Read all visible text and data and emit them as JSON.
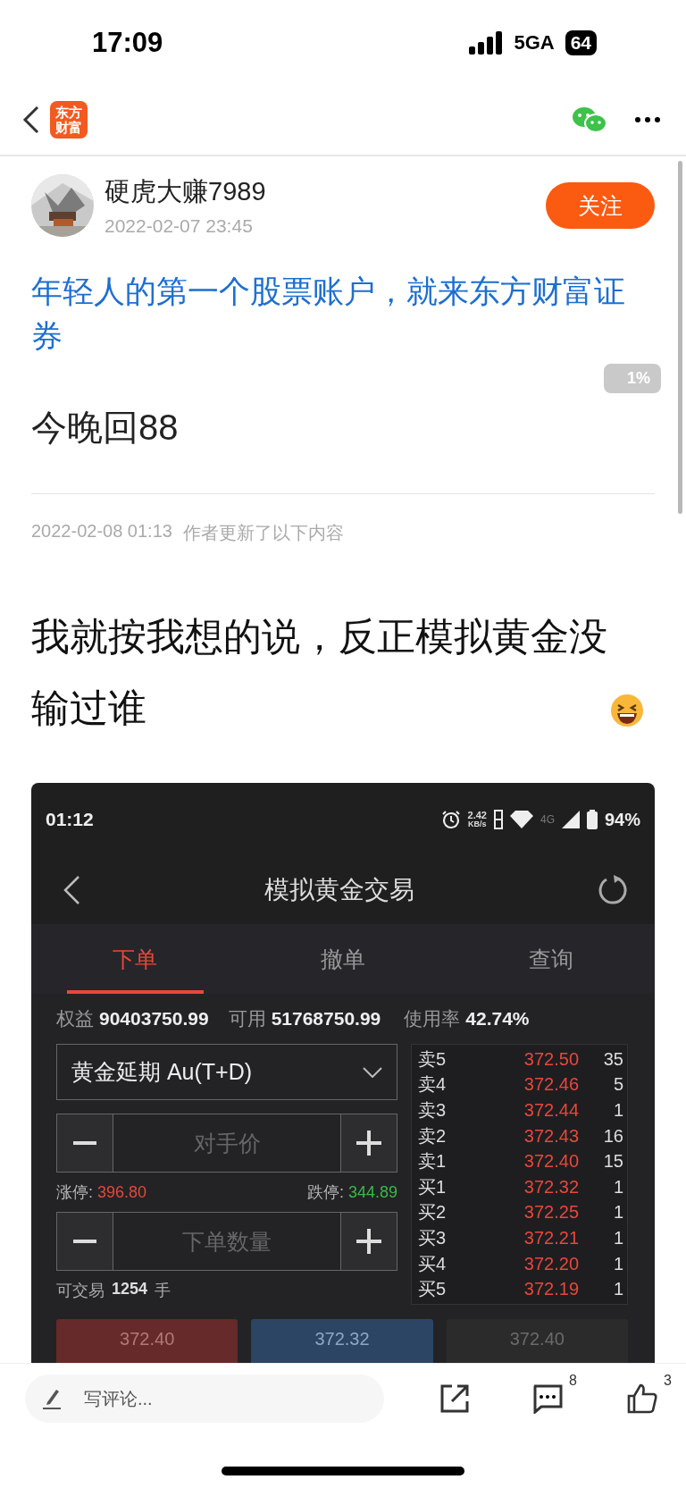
{
  "status_bar": {
    "time": "17:09",
    "network": "5GA",
    "battery": "64"
  },
  "app_bar": {
    "logo_lines": [
      "东方",
      "财富"
    ]
  },
  "post": {
    "author": "硬虎大赚7989",
    "date": "2022-02-07 23:45",
    "follow_button": "关注",
    "promo_link": "年轻人的第一个股票账户，就来东方财富证券",
    "title": "今晚回88",
    "update_time": "2022-02-08 01:13",
    "update_note": "作者更新了以下内容",
    "body": "我就按我想的说，反正模拟黄金没输过谁"
  },
  "scroll_indicator": {
    "label": "1%"
  },
  "screenshot": {
    "status_bar": {
      "time": "01:12",
      "speed": "2.42",
      "speed_unit": "KB/s",
      "network": "4G",
      "battery": "94%"
    },
    "title": "模拟黄金交易",
    "tabs": [
      {
        "label": "下单",
        "selected": true
      },
      {
        "label": "撤单",
        "selected": false
      },
      {
        "label": "查询",
        "selected": false
      }
    ],
    "summary": [
      {
        "label": "权益",
        "value": "90403750.99"
      },
      {
        "label": "可用",
        "value": "51768750.99"
      },
      {
        "label": "使用率",
        "value": "42.74%"
      }
    ],
    "contract": "黄金延期 Au(T+D)",
    "price_placeholder": "对手价",
    "limit_up": {
      "label": "涨停:",
      "value": "396.80"
    },
    "limit_down": {
      "label": "跌停:",
      "value": "344.89"
    },
    "quantity_placeholder": "下单数量",
    "tradable": {
      "label": "可交易",
      "value": "1254",
      "unit": "手"
    },
    "order_book": [
      {
        "label": "卖5",
        "price": "372.50",
        "volume": "35"
      },
      {
        "label": "卖4",
        "price": "372.46",
        "volume": "5"
      },
      {
        "label": "卖3",
        "price": "372.44",
        "volume": "1"
      },
      {
        "label": "卖2",
        "price": "372.43",
        "volume": "16"
      },
      {
        "label": "卖1",
        "price": "372.40",
        "volume": "15"
      },
      {
        "label": "买1",
        "price": "372.32",
        "volume": "1"
      },
      {
        "label": "买2",
        "price": "372.25",
        "volume": "1"
      },
      {
        "label": "买3",
        "price": "372.21",
        "volume": "1"
      },
      {
        "label": "买4",
        "price": "372.20",
        "volume": "1"
      },
      {
        "label": "买5",
        "price": "372.19",
        "volume": "1"
      }
    ],
    "action_buttons": [
      {
        "kind": "buy",
        "price": "372.40"
      },
      {
        "kind": "sell",
        "price": "372.32"
      },
      {
        "kind": "close",
        "price": "372.40"
      }
    ]
  },
  "bottom_bar": {
    "comment_placeholder": "写评论...",
    "comment_count": "8",
    "like_count": "3"
  }
}
